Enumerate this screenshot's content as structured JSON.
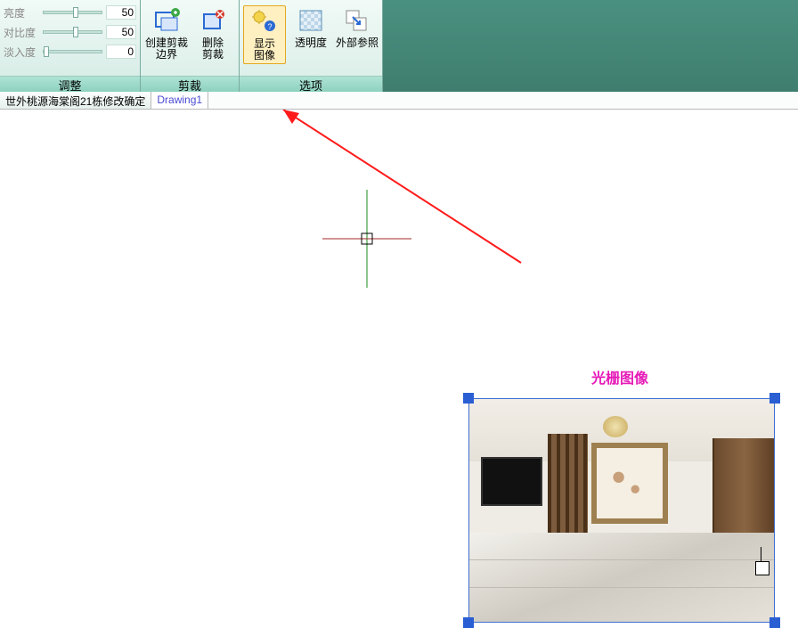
{
  "adjust": {
    "rows": [
      {
        "label": "亮度",
        "value": "50",
        "thumb_pct": 50
      },
      {
        "label": "对比度",
        "value": "50",
        "thumb_pct": 50
      },
      {
        "label": "淡入度",
        "value": "0",
        "thumb_pct": 0
      }
    ],
    "panel_title": "调整"
  },
  "clip": {
    "buttons": [
      {
        "label": "创建剪裁\n边界",
        "icon": "create-clip"
      },
      {
        "label": "删除\n剪裁",
        "icon": "delete-clip"
      }
    ],
    "panel_title": "剪裁"
  },
  "options": {
    "buttons": [
      {
        "label": "显示\n图像",
        "icon": "show-image",
        "active": true
      },
      {
        "label": "透明度",
        "icon": "transparency"
      },
      {
        "label": "外部参照",
        "icon": "xref"
      }
    ],
    "panel_title": "选项"
  },
  "tabs": {
    "items": [
      "世外桃源海棠阁21栋修改确定",
      "Drawing1"
    ],
    "active_index": 1
  },
  "canvas": {
    "annotation_label": "光栅图像"
  }
}
